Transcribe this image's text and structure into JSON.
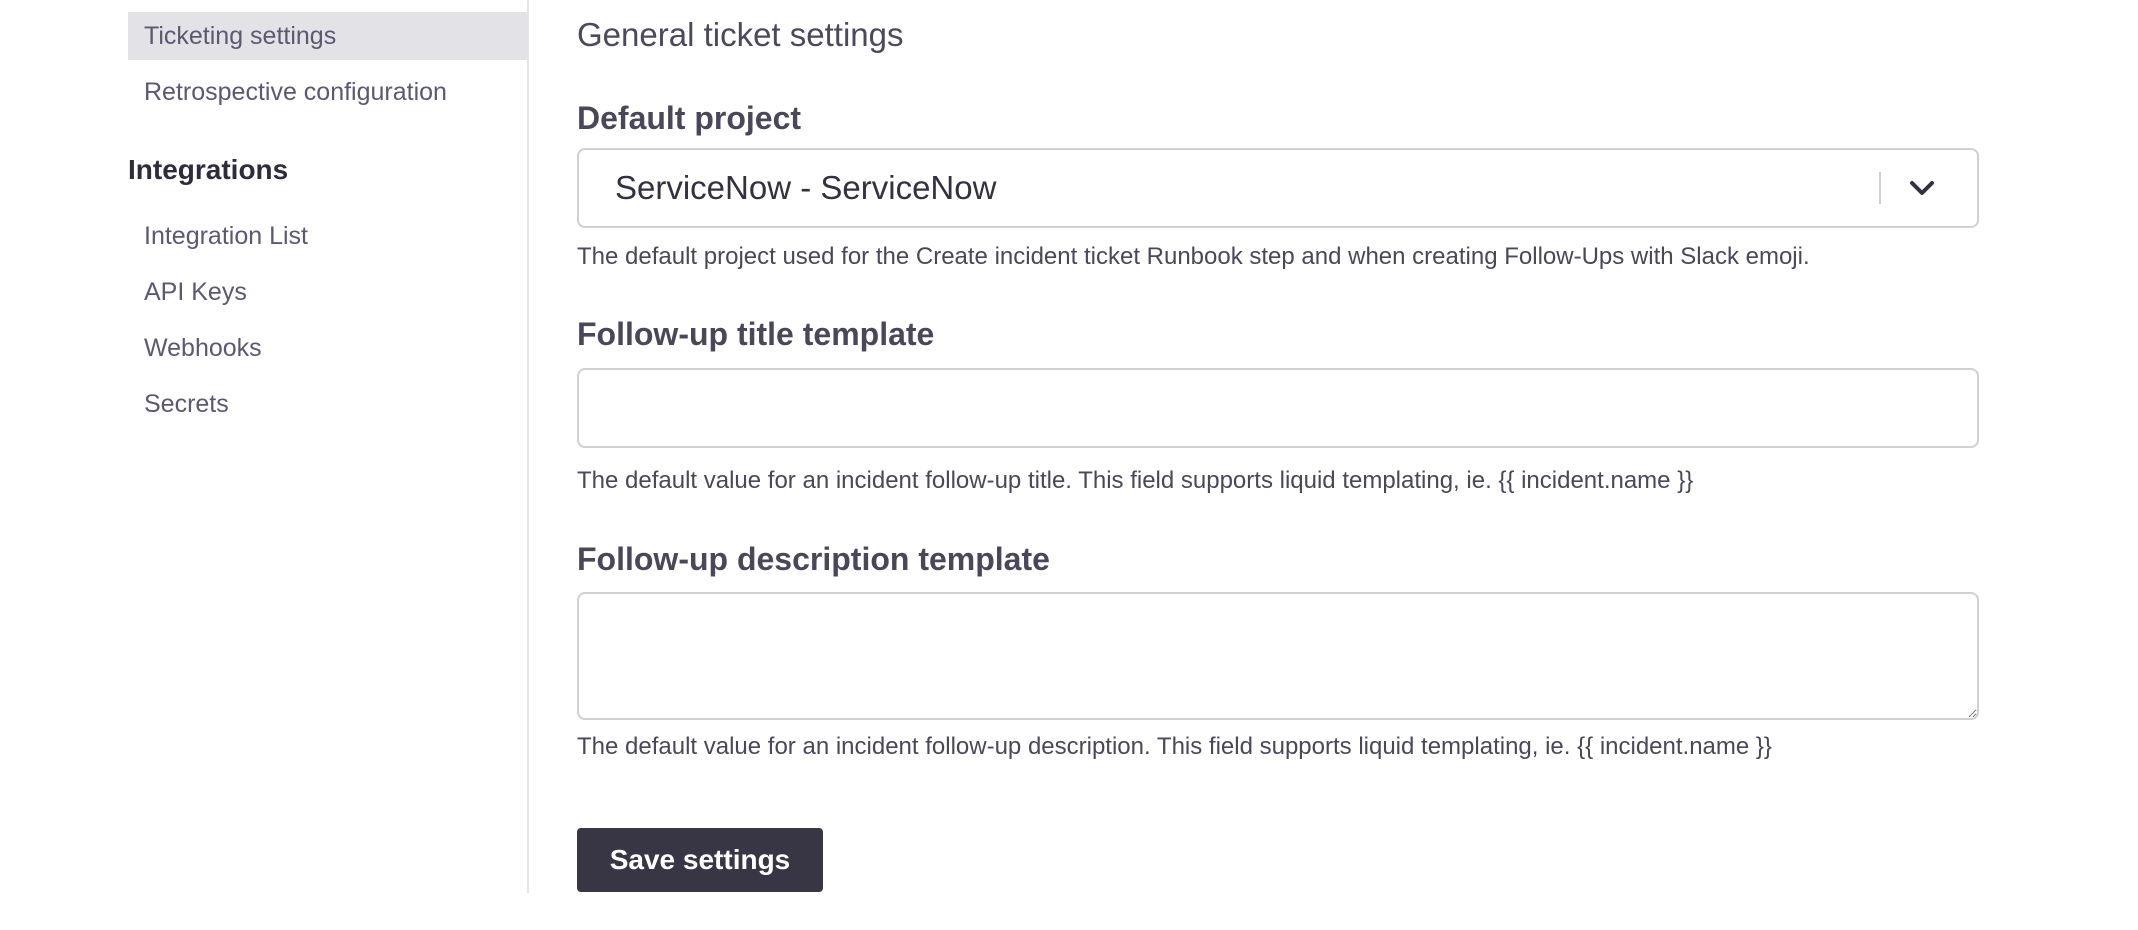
{
  "sidebar": {
    "items_top": [
      {
        "label": "Ticketing settings",
        "active": true
      },
      {
        "label": "Retrospective configuration",
        "active": false
      }
    ],
    "sections": [
      {
        "heading": "Integrations",
        "items": [
          {
            "label": "Integration List"
          },
          {
            "label": "API Keys"
          },
          {
            "label": "Webhooks"
          },
          {
            "label": "Secrets"
          }
        ]
      }
    ]
  },
  "main": {
    "section_title": "General ticket settings",
    "default_project": {
      "label": "Default project",
      "selected_value": "ServiceNow - ServiceNow",
      "chevron_icon": "chevron-down-icon",
      "help": "The default project used for the Create incident ticket Runbook step and when creating Follow-Ups with Slack emoji."
    },
    "followup_title": {
      "label": "Follow-up title template",
      "value": "",
      "placeholder": "",
      "help": "The default value for an incident follow-up title. This field supports liquid templating, ie. {{ incident.name }}"
    },
    "followup_description": {
      "label": "Follow-up description template",
      "value": "",
      "placeholder": "",
      "help": "The default value for an incident follow-up description. This field supports liquid templating, ie. {{ incident.name }}"
    },
    "save_label": "Save settings"
  },
  "colors": {
    "active_nav_bg": "#e3e2e7",
    "primary_button_bg": "#383644",
    "border": "#d0cfd6",
    "text": "#4a4858"
  }
}
